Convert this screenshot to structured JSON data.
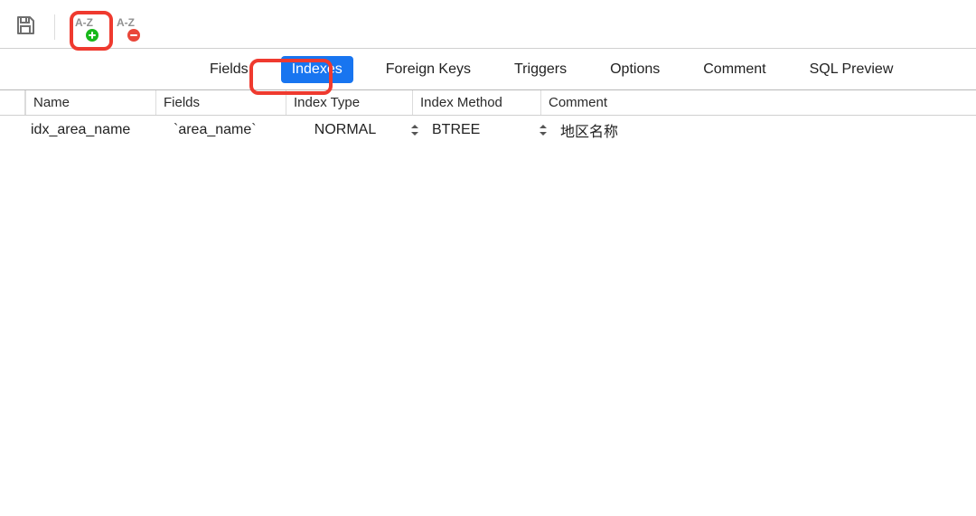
{
  "toolbar": {
    "save_label": "Save",
    "add_index_text": "A-Z",
    "remove_index_text": "A-Z"
  },
  "tabs": {
    "fields": "Fields",
    "indexes": "Indexes",
    "foreign_keys": "Foreign Keys",
    "triggers": "Triggers",
    "options": "Options",
    "comment": "Comment",
    "sql_preview": "SQL Preview"
  },
  "columns": {
    "name": "Name",
    "fields": "Fields",
    "index_type": "Index Type",
    "index_method": "Index Method",
    "comment": "Comment"
  },
  "rows": [
    {
      "name": "idx_area_name",
      "fields": "`area_name`",
      "index_type": "NORMAL",
      "index_method": "BTREE",
      "comment": "地区名称"
    }
  ]
}
